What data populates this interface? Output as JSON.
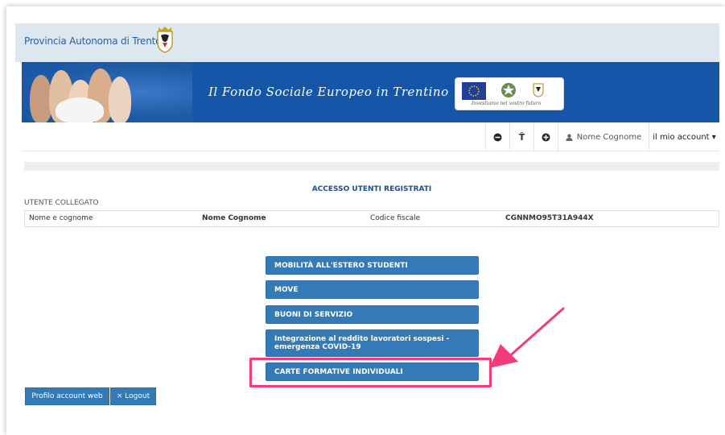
{
  "header": {
    "title": "Provincia Autonoma di Trento"
  },
  "banner": {
    "slogan": "Il Fondo Sociale Europeo in Trentino",
    "logos_tagline": "Investiamo nel vostro futuro"
  },
  "nav": {
    "decrease_font": "−",
    "font_size": "T̂",
    "increase_font": "+",
    "user_name": "Nome Cognome",
    "account_menu": "il mio account ▾"
  },
  "main": {
    "heading": "ACCESSO UTENTI REGISTRATI",
    "user_section_label": "UTENTE COLLEGATO",
    "user_table": {
      "name_label": "Nome e cognome",
      "name_value": "Nome Cognome",
      "tax_code_label": "Codice fiscale",
      "tax_code_value": "CGNNMO95T31A944X"
    },
    "services": [
      "MOBILITÀ ALL'ESTERO STUDENTI",
      "MOVE",
      "BUONI DI SERVIZIO",
      "Integrazione al reddito lavoratori sospesi - emergenza COVID-19",
      "CARTE FORMATIVE INDIVIDUALI"
    ]
  },
  "footer_buttons": {
    "profile": "Profilo account web",
    "logout": "× Logout"
  },
  "colors": {
    "brand_blue": "#1556a8",
    "button_blue": "#337ab7",
    "highlight_pink": "#f03c7d",
    "topbar_bg": "#dde7f0"
  },
  "icons": [
    "crest-icon",
    "minus-circle-icon",
    "text-size-icon",
    "plus-circle-icon",
    "user-icon",
    "caret-down-icon"
  ]
}
